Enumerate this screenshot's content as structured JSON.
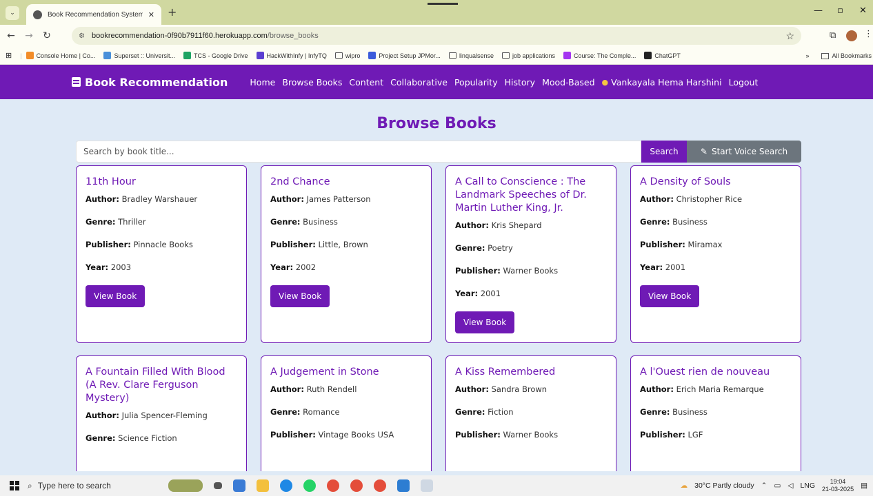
{
  "browser": {
    "tab_title": "Book Recommendation System",
    "tab_close": "✕",
    "new_tab": "+",
    "url_host": "bookrecommendation-0f90b7911f60.herokuapp.com",
    "url_path": "/browse_books",
    "bookmarks": [
      {
        "label": "Console Home | Co...",
        "color": "#f28c28"
      },
      {
        "label": "Superset :: Universit...",
        "color": "#4a90d9"
      },
      {
        "label": "TCS - Google Drive",
        "color": "#1fa463"
      },
      {
        "label": "HackWithInfy | InfyTQ",
        "color": "#5b3fd1"
      },
      {
        "label": "wipro",
        "color": "folder"
      },
      {
        "label": "Project Setup JPMor...",
        "color": "#3b5bdb"
      },
      {
        "label": "linqualsense",
        "color": "folder"
      },
      {
        "label": "job applications",
        "color": "folder"
      },
      {
        "label": "Course: The Comple...",
        "color": "#a435f0"
      },
      {
        "label": "ChatGPT",
        "color": "#222222"
      }
    ],
    "all_bookmarks": "All Bookmarks"
  },
  "navbar": {
    "brand": "Book Recommendation",
    "links": [
      "Home",
      "Browse Books",
      "Content",
      "Collaborative",
      "Popularity",
      "History",
      "Mood-Based"
    ],
    "user": "Vankayala Hema Harshini",
    "logout": "Logout",
    "accent": "#6f1ab5"
  },
  "page": {
    "title": "Browse Books",
    "search_placeholder": "Search by book title...",
    "search_button": "Search",
    "voice_button": "Start Voice Search"
  },
  "labels": {
    "author": "Author:",
    "genre": "Genre:",
    "publisher": "Publisher:",
    "year": "Year:",
    "view": "View Book"
  },
  "books": [
    {
      "title": "11th Hour",
      "author": "Bradley Warshauer",
      "genre": "Thriller",
      "publisher": "Pinnacle Books",
      "year": "2003"
    },
    {
      "title": "2nd Chance",
      "author": "James Patterson",
      "genre": "Business",
      "publisher": "Little, Brown",
      "year": "2002"
    },
    {
      "title": "A Call to Conscience : The Landmark Speeches of Dr. Martin Luther King, Jr.",
      "author": "Kris Shepard",
      "genre": "Poetry",
      "publisher": "Warner Books",
      "year": "2001"
    },
    {
      "title": "A Density of Souls",
      "author": "Christopher Rice",
      "genre": "Business",
      "publisher": "Miramax",
      "year": "2001"
    },
    {
      "title": "A Fountain Filled With Blood (A Rev. Clare Ferguson Mystery)",
      "author": "Julia Spencer-Fleming",
      "genre": "Science Fiction",
      "publisher": "",
      "year": ""
    },
    {
      "title": "A Judgement in Stone",
      "author": "Ruth Rendell",
      "genre": "Romance",
      "publisher": "Vintage Books USA",
      "year": ""
    },
    {
      "title": "A Kiss Remembered",
      "author": "Sandra Brown",
      "genre": "Fiction",
      "publisher": "Warner Books",
      "year": ""
    },
    {
      "title": "A l'Ouest rien de nouveau",
      "author": "Erich Maria Remarque",
      "genre": "Business",
      "publisher": "LGF",
      "year": ""
    }
  ],
  "taskbar": {
    "search_placeholder": "Type here to search",
    "weather": "30°C  Partly cloudy",
    "lang": "LNG",
    "time": "19:04",
    "date": "21-03-2025"
  }
}
